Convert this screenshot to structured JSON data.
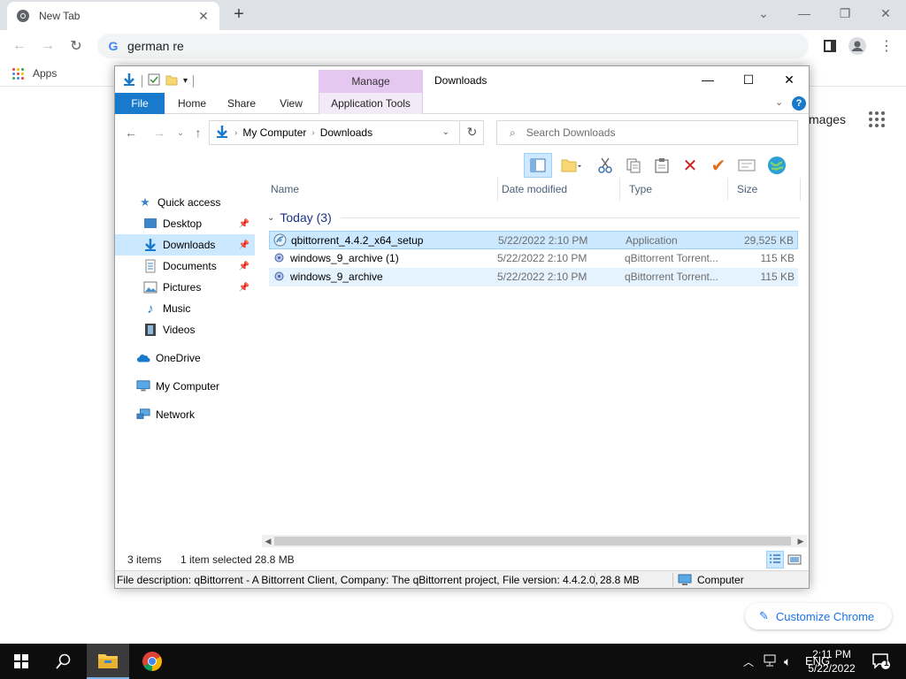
{
  "chrome": {
    "tab_title": "New Tab",
    "address_value": "german re",
    "bookmarks_apps": "Apps",
    "ntp_images": "mages",
    "customize_label": "Customize Chrome"
  },
  "explorer": {
    "window_title": "Downloads",
    "contextual_group": "Manage",
    "ribbon_tabs": {
      "file": "File",
      "home": "Home",
      "share": "Share",
      "view": "View",
      "app_tools": "Application Tools"
    },
    "breadcrumb": [
      "My Computer",
      "Downloads"
    ],
    "search_placeholder": "Search Downloads",
    "nav": {
      "quick_access": "Quick access",
      "desktop": "Desktop",
      "downloads": "Downloads",
      "documents": "Documents",
      "pictures": "Pictures",
      "music": "Music",
      "videos": "Videos",
      "onedrive": "OneDrive",
      "my_computer": "My Computer",
      "network": "Network"
    },
    "columns": {
      "name": "Name",
      "date": "Date modified",
      "type": "Type",
      "size": "Size"
    },
    "group_label": "Today (3)",
    "files": [
      {
        "name": "qbittorrent_4.4.2_x64_setup",
        "date": "5/22/2022 2:10 PM",
        "type": "Application",
        "size": "29,525 KB"
      },
      {
        "name": "windows_9_archive (1)",
        "date": "5/22/2022 2:10 PM",
        "type": "qBittorrent Torrent...",
        "size": "115 KB"
      },
      {
        "name": "windows_9_archive",
        "date": "5/22/2022 2:10 PM",
        "type": "qBittorrent Torrent...",
        "size": "115 KB"
      }
    ],
    "status": {
      "items": "3 items",
      "selected": "1 item selected",
      "size": "28.8 MB"
    },
    "details": {
      "description": "File description: qBittorrent - A Bittorrent Client, Company: The qBittorrent project, File version: 4.4.2.0,",
      "size": "28.8 MB",
      "location": "Computer"
    }
  },
  "taskbar": {
    "time": "2:11 PM",
    "date": "5/22/2022",
    "notification_count": "1"
  },
  "colors": {
    "file_tab_blue": "#1979ca",
    "manage_band": "#e5c7f0",
    "selection": "#cce8ff",
    "group_header": "#1e3287"
  }
}
